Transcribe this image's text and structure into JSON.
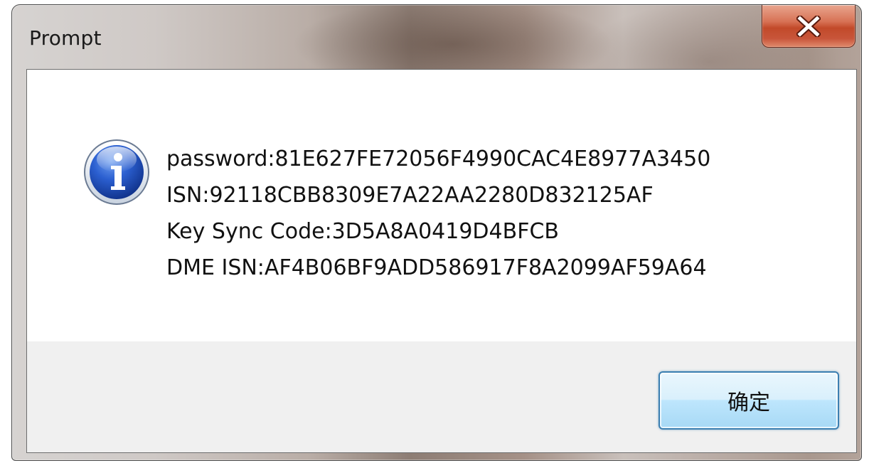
{
  "window": {
    "title": "Prompt",
    "close_icon": "close-icon"
  },
  "message": {
    "icon": "info-icon",
    "lines": [
      "password:81E627FE72056F4990CAC4E8977A3450",
      "ISN:92118CBB8309E7A22AA2280D832125AF",
      "Key Sync Code:3D5A8A0419D4BFCB",
      "DME ISN:AF4B06BF9ADD586917F8A2099AF59A64"
    ]
  },
  "buttons": {
    "ok_label": "确定"
  },
  "colors": {
    "close_button": "#c8553a",
    "ok_button_border": "#3c7fb1",
    "info_icon_blue": "#1f4fb0"
  }
}
